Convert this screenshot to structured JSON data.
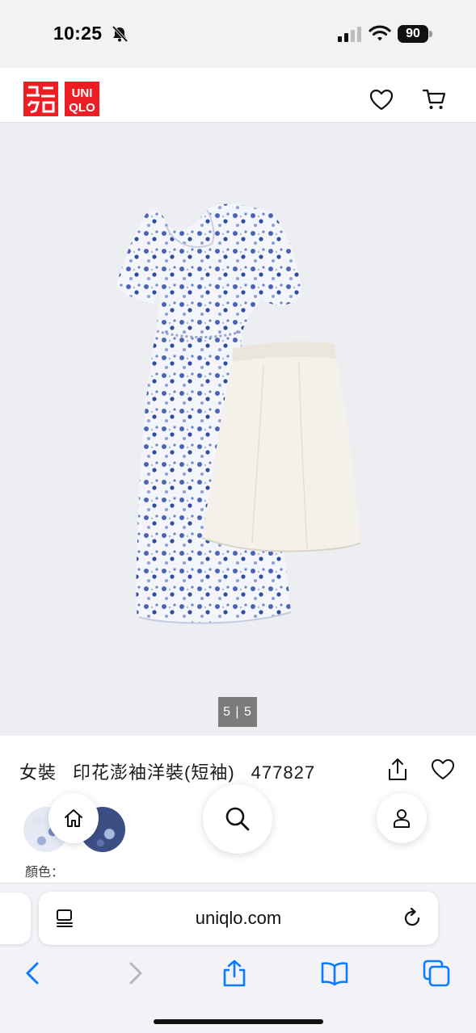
{
  "status_bar": {
    "time": "10:25",
    "battery": "90",
    "icons": [
      "bell-slash-icon",
      "cellular-signal-icon",
      "wifi-icon",
      "battery-icon"
    ]
  },
  "header": {
    "logo_top": "ユニ",
    "logo_bottom": "クロ",
    "logo_right_top": "UNI",
    "logo_right_bottom": "QLO",
    "brand_color": "#ed1d24",
    "icons": [
      "heart-icon",
      "cart-icon"
    ]
  },
  "gallery": {
    "pager": "5 | 5"
  },
  "product": {
    "category": "女裝",
    "name": "印花澎袖洋裝(短袖)",
    "code": "477827",
    "colour_label": "顏色："
  },
  "browser": {
    "url": "uniqlo.com",
    "accent": "#0a7aff"
  }
}
